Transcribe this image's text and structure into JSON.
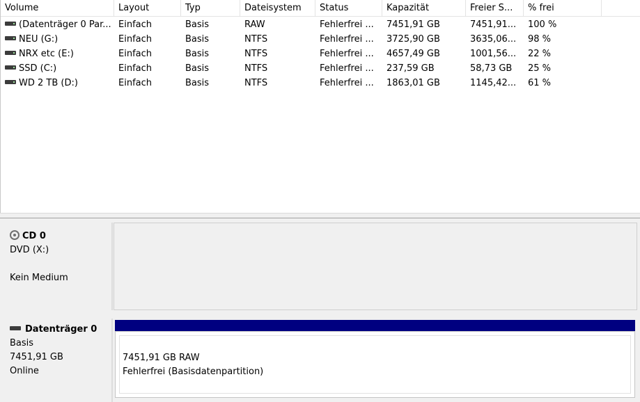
{
  "volume_list": {
    "columns": [
      "Volume",
      "Layout",
      "Typ",
      "Dateisystem",
      "Status",
      "Kapazität",
      "Freier S...",
      "% frei",
      ""
    ],
    "rows": [
      [
        "(Datenträger 0 Par...",
        "Einfach",
        "Basis",
        "RAW",
        "Fehlerfrei ...",
        "7451,91 GB",
        "7451,91...",
        "100 %"
      ],
      [
        "NEU (G:)",
        "Einfach",
        "Basis",
        "NTFS",
        "Fehlerfrei ...",
        "3725,90 GB",
        "3635,06...",
        "98 %"
      ],
      [
        "NRX etc (E:)",
        "Einfach",
        "Basis",
        "NTFS",
        "Fehlerfrei ...",
        "4657,49 GB",
        "1001,56...",
        "22 %"
      ],
      [
        "SSD (C:)",
        "Einfach",
        "Basis",
        "NTFS",
        "Fehlerfrei ...",
        "237,59 GB",
        "58,73 GB",
        "25 %"
      ],
      [
        "WD 2 TB (D:)",
        "Einfach",
        "Basis",
        "NTFS",
        "Fehlerfrei ...",
        "1863,01 GB",
        "1145,42...",
        "61 %"
      ]
    ]
  },
  "disks": {
    "cd": {
      "icon": "cd-drive-icon",
      "title": "CD 0",
      "line1": "DVD (X:)",
      "line2": "",
      "line3": "Kein Medium"
    },
    "disk0": {
      "icon": "hard-disk-icon",
      "title": "Datenträger 0",
      "type": "Basis",
      "size": "7451,91 GB",
      "state": "Online",
      "partition": {
        "size_fs": "7451,91 GB RAW",
        "status": "Fehlerfrei (Basisdatenpartition)",
        "bar_color": "#000080"
      }
    }
  }
}
